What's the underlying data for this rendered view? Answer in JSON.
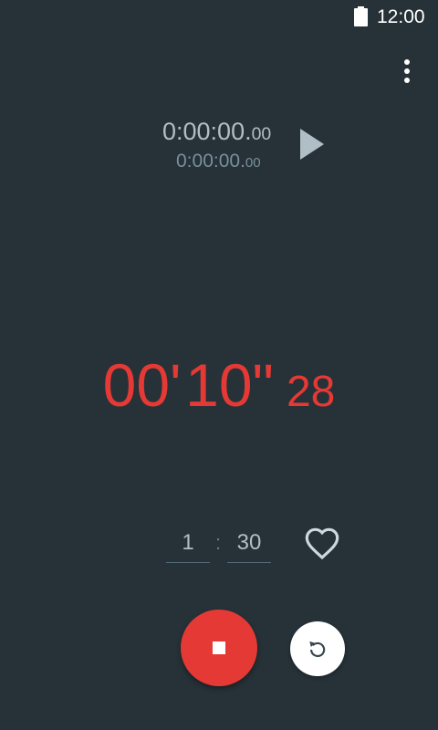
{
  "status_bar": {
    "time": "12:00",
    "battery_icon": "battery-full-icon"
  },
  "menu": {
    "icon": "more-vert-icon"
  },
  "laps": {
    "primary": {
      "main": "0:00:00.",
      "centis": "00"
    },
    "secondary": {
      "main": "0:00:00.",
      "centis": "00"
    }
  },
  "play": {
    "icon": "play-icon"
  },
  "timer": {
    "minutes": "00'",
    "seconds": "10\"",
    "centis": "28"
  },
  "interval": {
    "minutes": "1",
    "separator": ":",
    "seconds": "30"
  },
  "favorite": {
    "icon": "heart-outline-icon"
  },
  "controls": {
    "stop_icon": "stop-icon",
    "reset_icon": "reset-icon"
  },
  "colors": {
    "background": "#263238",
    "accent": "#e53935",
    "primary_text": "#b0bec5",
    "secondary_text": "#78909c"
  }
}
